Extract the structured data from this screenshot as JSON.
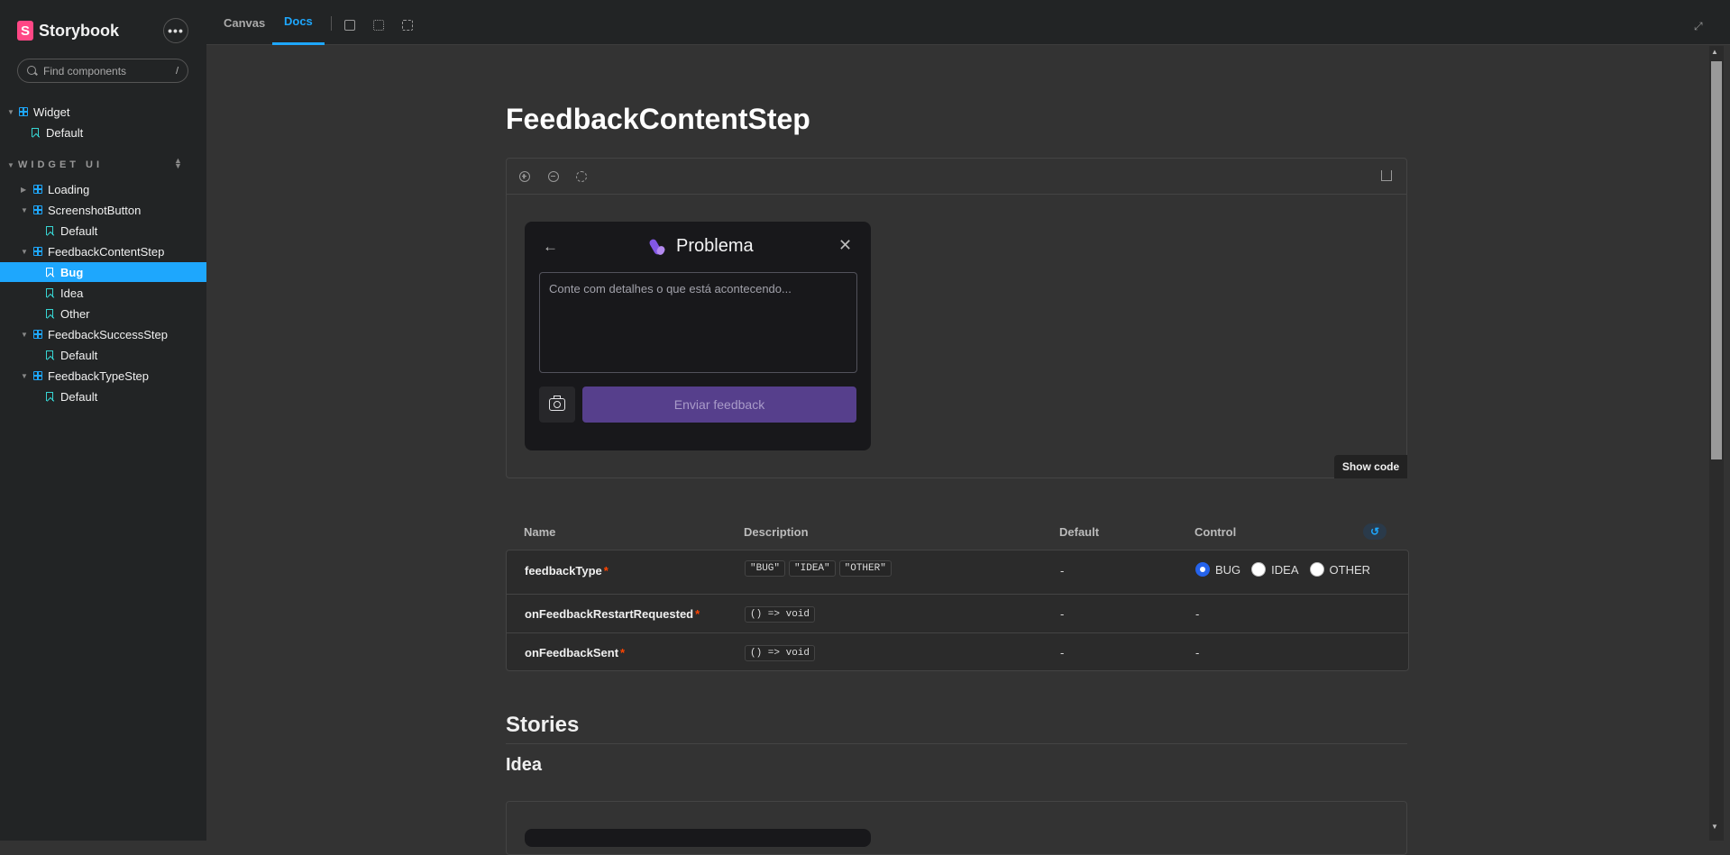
{
  "sidebar": {
    "brand": "Storybook",
    "more": "•••",
    "search_placeholder": "Find components",
    "search_shortcut": "/",
    "group_label": "WIDGET UI",
    "items": [
      {
        "label": "Widget",
        "kind": "component"
      },
      {
        "label": "Default",
        "kind": "story"
      },
      {
        "label": "Loading",
        "kind": "component"
      },
      {
        "label": "ScreenshotButton",
        "kind": "component"
      },
      {
        "label": "Default",
        "kind": "story"
      },
      {
        "label": "FeedbackContentStep",
        "kind": "component"
      },
      {
        "label": "Bug",
        "kind": "story",
        "active": true
      },
      {
        "label": "Idea",
        "kind": "story"
      },
      {
        "label": "Other",
        "kind": "story"
      },
      {
        "label": "FeedbackSuccessStep",
        "kind": "component"
      },
      {
        "label": "Default",
        "kind": "story"
      },
      {
        "label": "FeedbackTypeStep",
        "kind": "component"
      },
      {
        "label": "Default",
        "kind": "story"
      }
    ]
  },
  "toolbar": {
    "tabs": [
      "Canvas",
      "Docs"
    ],
    "active_tab": "Docs"
  },
  "doc": {
    "title": "FeedbackContentStep",
    "widget": {
      "title": "Problema",
      "placeholder": "Conte com detalhes o que está acontecendo...",
      "submit_label": "Enviar feedback"
    },
    "show_code": "Show code"
  },
  "props": {
    "headers": [
      "Name",
      "Description",
      "Default",
      "Control"
    ],
    "rows": [
      {
        "name": "feedbackType",
        "required": "*",
        "desc": [
          "\"BUG\"",
          "\"IDEA\"",
          "\"OTHER\""
        ],
        "default": "-",
        "control_options": [
          "BUG",
          "IDEA",
          "OTHER"
        ],
        "selected": "BUG"
      },
      {
        "name": "onFeedbackRestartRequested",
        "required": "*",
        "desc": [
          "() => void"
        ],
        "default": "-",
        "control": "-"
      },
      {
        "name": "onFeedbackSent",
        "required": "*",
        "desc": [
          "() => void"
        ],
        "default": "-",
        "control": "-"
      }
    ]
  },
  "stories": {
    "heading": "Stories",
    "first_story": "Idea"
  },
  "colors": {
    "accent": "#1ea7fd",
    "brand": "#ff4785",
    "widget_submit": "#563f8c"
  }
}
